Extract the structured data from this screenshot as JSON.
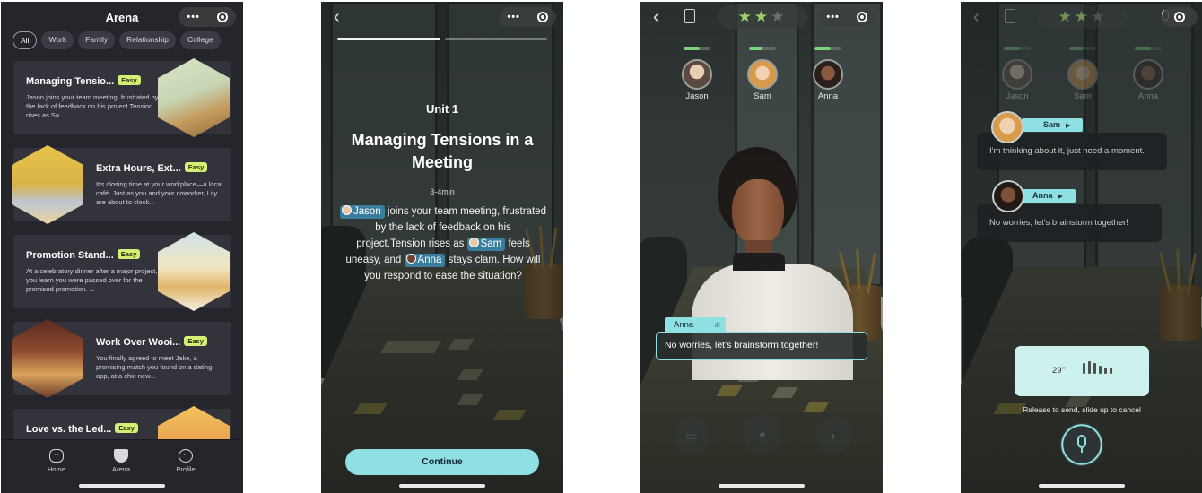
{
  "screen_arena": {
    "title": "Arena",
    "filters": [
      "All",
      "Work",
      "Family",
      "Relationship",
      "College"
    ],
    "cards": [
      {
        "title": "Managing Tensio...",
        "badge": "Easy",
        "desc": "Jason joins your team meeting, frustrated by the lack of feedback on his project.Tension rises as Sa..."
      },
      {
        "title": "Extra Hours, Ext...",
        "badge": "Easy",
        "desc": "It's closing time at your workplace—a local café. Just as you and your coworker, Lily are about to clock..."
      },
      {
        "title": "Promotion Stand...",
        "badge": "Easy",
        "desc": "At a celebratory dinner after a major project, you learn you were passed over for the promised promotion. ..."
      },
      {
        "title": "Work Over Wooi...",
        "badge": "Easy",
        "desc": "You finally agreed to meet Jake, a promising match you found on a dating app, at a chic new..."
      },
      {
        "title": "Love vs. the Led...",
        "badge": "Easy",
        "desc": ""
      }
    ],
    "tabs": [
      {
        "label": "Home"
      },
      {
        "label": "Arena"
      },
      {
        "label": "Profile"
      }
    ]
  },
  "screen_intro": {
    "unit": "Unit 1",
    "title": "Managing Tensions in a Meeting",
    "duration": "3-4min",
    "story": {
      "p1_name": "Jason",
      "p1_text": " joins your team meeting, frustrated by the lack of feedback on his project.Tension rises as ",
      "p2_name": "Sam",
      "p2_text": " feels uneasy, and ",
      "p3_name": "Anna",
      "p3_text": " stays clam. How will you respond to ease the situation?"
    },
    "continue_label": "Continue",
    "progress": [
      1,
      0
    ]
  },
  "screen_chat": {
    "stars_filled": 2,
    "stars_total": 3,
    "participants": [
      {
        "name": "Jason",
        "progress": 0.6
      },
      {
        "name": "Sam",
        "progress": 0.5
      },
      {
        "name": "Anna",
        "progress": 0.6
      }
    ],
    "speaker": "Anna",
    "subtitle": "No worries, let's brainstorm together!"
  },
  "screen_record": {
    "messages": [
      {
        "name": "Sam",
        "text": "I'm thinking about it, just need a moment."
      },
      {
        "name": "Anna",
        "text": "No worries, let's brainstorm together!"
      }
    ],
    "record_seconds": "29''",
    "hint": "Release to send, slide up to cancel"
  },
  "colors": {
    "accent": "#8ee0e2",
    "badge": "#d4ef74",
    "star_on": "#9ed16e",
    "dark_bg": "#25252c"
  },
  "icons": [
    "back-icon",
    "more-icon",
    "target-icon",
    "notes-icon",
    "star-icon",
    "mic-icon",
    "keyboard-icon",
    "hint-icon",
    "home-icon",
    "trophy-icon",
    "profile-icon"
  ]
}
